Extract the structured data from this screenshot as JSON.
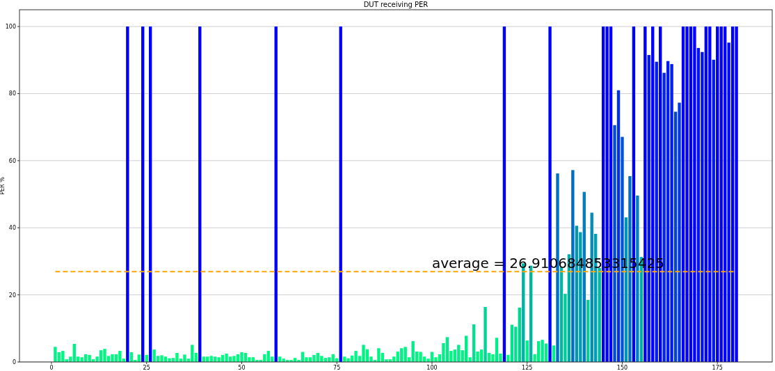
{
  "chart_data": {
    "type": "bar",
    "title": "DUT receiving PER",
    "ylabel": "PER %",
    "x": [
      1,
      2,
      3,
      4,
      5,
      6,
      7,
      8,
      9,
      10,
      11,
      12,
      13,
      14,
      15,
      16,
      17,
      18,
      19,
      20,
      21,
      22,
      23,
      24,
      25,
      26,
      27,
      28,
      29,
      30,
      31,
      32,
      33,
      34,
      35,
      36,
      37,
      38,
      39,
      40,
      41,
      42,
      43,
      44,
      45,
      46,
      47,
      48,
      49,
      50,
      51,
      52,
      53,
      54,
      55,
      56,
      57,
      58,
      59,
      60,
      61,
      62,
      63,
      64,
      65,
      66,
      67,
      68,
      69,
      70,
      71,
      72,
      73,
      74,
      75,
      76,
      77,
      78,
      79,
      80,
      81,
      82,
      83,
      84,
      85,
      86,
      87,
      88,
      89,
      90,
      91,
      92,
      93,
      94,
      95,
      96,
      97,
      98,
      99,
      100,
      101,
      102,
      103,
      104,
      105,
      106,
      107,
      108,
      109,
      110,
      111,
      112,
      113,
      114,
      115,
      116,
      117,
      118,
      119,
      120,
      121,
      122,
      123,
      124,
      125,
      126,
      127,
      128,
      129,
      130,
      131,
      132,
      133,
      134,
      135,
      136,
      137,
      138,
      139,
      140,
      141,
      142,
      143,
      144,
      145,
      146,
      147,
      148,
      149,
      150,
      151,
      152,
      153,
      154,
      155,
      156,
      157,
      158,
      159,
      160,
      161,
      162,
      163,
      164,
      165,
      166,
      167,
      168,
      169,
      170,
      171,
      172,
      173,
      174,
      175,
      176,
      177,
      178,
      179,
      180
    ],
    "grid": "y",
    "series": [
      {
        "values": [
          4.5,
          2.9,
          3.3,
          0.8,
          1.6,
          5.4,
          1.6,
          1.4,
          2.3,
          2.1,
          0.8,
          1.6,
          3.5,
          3.9,
          1.8,
          2.3,
          2.3,
          3.3,
          1.0,
          100,
          2.9,
          0.6,
          2.2,
          100,
          2.1,
          100,
          3.7,
          1.8,
          2.0,
          1.6,
          1.1,
          1.2,
          2.7,
          1.0,
          2.2,
          1.0,
          5.1,
          2.7,
          100,
          1.6,
          1.6,
          1.8,
          1.6,
          1.4,
          2.1,
          2.5,
          1.6,
          1.8,
          2.3,
          2.9,
          2.7,
          1.4,
          1.4,
          0.6,
          0.6,
          2.3,
          3.3,
          1.6,
          100,
          1.6,
          1.0,
          0.6,
          0.6,
          1.2,
          0.6,
          3.0,
          1.4,
          1.4,
          2.1,
          2.7,
          1.8,
          1.2,
          1.4,
          2.3,
          1.1,
          100,
          1.6,
          1.1,
          1.9,
          3.3,
          1.8,
          5.1,
          3.8,
          1.6,
          0.6,
          4.1,
          2.7,
          0.8,
          0.8,
          1.6,
          3.1,
          4.1,
          4.5,
          1.4,
          6.2,
          3.1,
          3.0,
          1.6,
          1.0,
          3.0,
          1.4,
          2.3,
          5.6,
          7.4,
          3.3,
          3.7,
          5.1,
          3.5,
          7.8,
          1.4,
          11.2,
          3.1,
          3.7,
          16.4,
          2.7,
          2.3,
          7.2,
          2.5,
          100,
          2.1,
          11.1,
          10.5,
          16.2,
          29.4,
          6.4,
          28.7,
          2.3,
          6.2,
          6.6,
          5.5,
          100,
          4.9,
          56.2,
          28.3,
          20.3,
          32.1,
          57.2,
          40.6,
          38.7,
          50.7,
          18.5,
          44.5,
          38.2,
          28,
          100,
          100,
          100,
          70.6,
          81,
          67.1,
          43.1,
          55.4,
          100,
          49.6,
          31.3,
          100,
          91.5,
          100,
          89.5,
          100,
          86.2,
          89.7,
          88.8,
          74.6,
          77.3,
          100,
          100,
          100,
          100,
          93.6,
          92.4,
          100,
          100,
          90.1,
          100,
          100,
          100,
          95.2,
          100,
          100
        ]
      }
    ],
    "xlim": [
      -8.4,
      189.4
    ],
    "ylim": [
      0,
      105
    ],
    "xticks": [
      0,
      25,
      50,
      75,
      100,
      125,
      150,
      175
    ],
    "yticks": [
      0,
      20,
      40,
      60,
      80,
      100
    ],
    "ref_lines": [
      {
        "axis": "y",
        "value": 26.910684853315423,
        "color": "#ffa500"
      }
    ],
    "annotations": [
      "average = 26.910684853315425"
    ]
  }
}
